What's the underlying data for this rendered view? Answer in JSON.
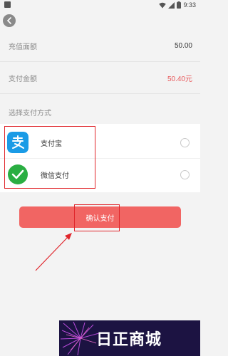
{
  "status_bar": {
    "time": "9:33"
  },
  "form": {
    "recharge_label": "充值面额",
    "recharge_value": "50.00",
    "pay_label": "支付金额",
    "pay_value": "50.40元",
    "method_label": "选择支付方式"
  },
  "methods": [
    {
      "name": "支付宝",
      "icon": "alipay-icon"
    },
    {
      "name": "微信支付",
      "icon": "wechat-icon"
    }
  ],
  "confirm_label": "确认支付",
  "watermark": {
    "text": "日正商城"
  },
  "colors": {
    "accent": "#f16563",
    "pay_amount": "#e8585a",
    "highlight": "#e0252b"
  }
}
